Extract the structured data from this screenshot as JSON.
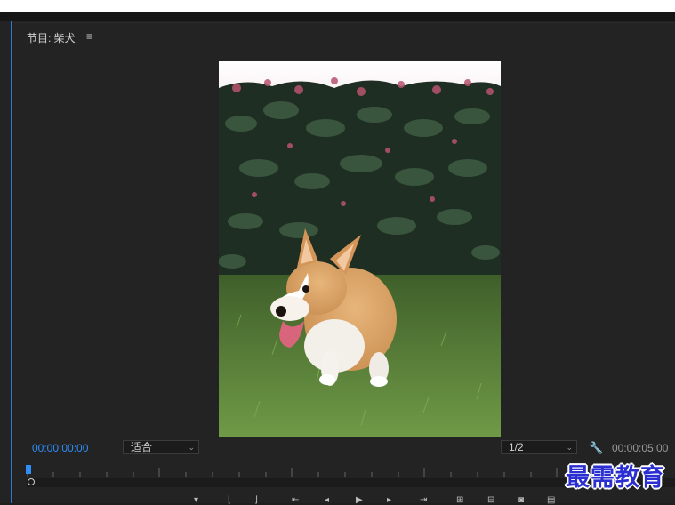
{
  "panel": {
    "title": "节目: 柴犬",
    "menu_icon": "hamburger-icon"
  },
  "viewer": {
    "image_subject": "corgi dog on grass in front of hedge"
  },
  "transport": {
    "timecode_current": "00:00:00:00",
    "timecode_total": "00:00:05:00",
    "fit_option": "适合",
    "resolution": "1/2",
    "settings_icon": "wrench-icon"
  },
  "controls": [
    {
      "icon": "marker-icon"
    },
    {
      "icon": "in-point-icon"
    },
    {
      "icon": "out-point-icon"
    },
    {
      "icon": "go-to-in-icon"
    },
    {
      "icon": "step-back-icon"
    },
    {
      "icon": "play-icon"
    },
    {
      "icon": "step-forward-icon"
    },
    {
      "icon": "go-to-out-icon"
    },
    {
      "icon": "insert-icon"
    },
    {
      "icon": "overwrite-icon"
    },
    {
      "icon": "export-frame-icon"
    },
    {
      "icon": "button-editor-icon"
    }
  ],
  "watermark": {
    "text": "最需教育"
  },
  "colors": {
    "accent": "#2f8ff7",
    "panel_bg": "#232323",
    "watermark": "#2b2fd1"
  }
}
